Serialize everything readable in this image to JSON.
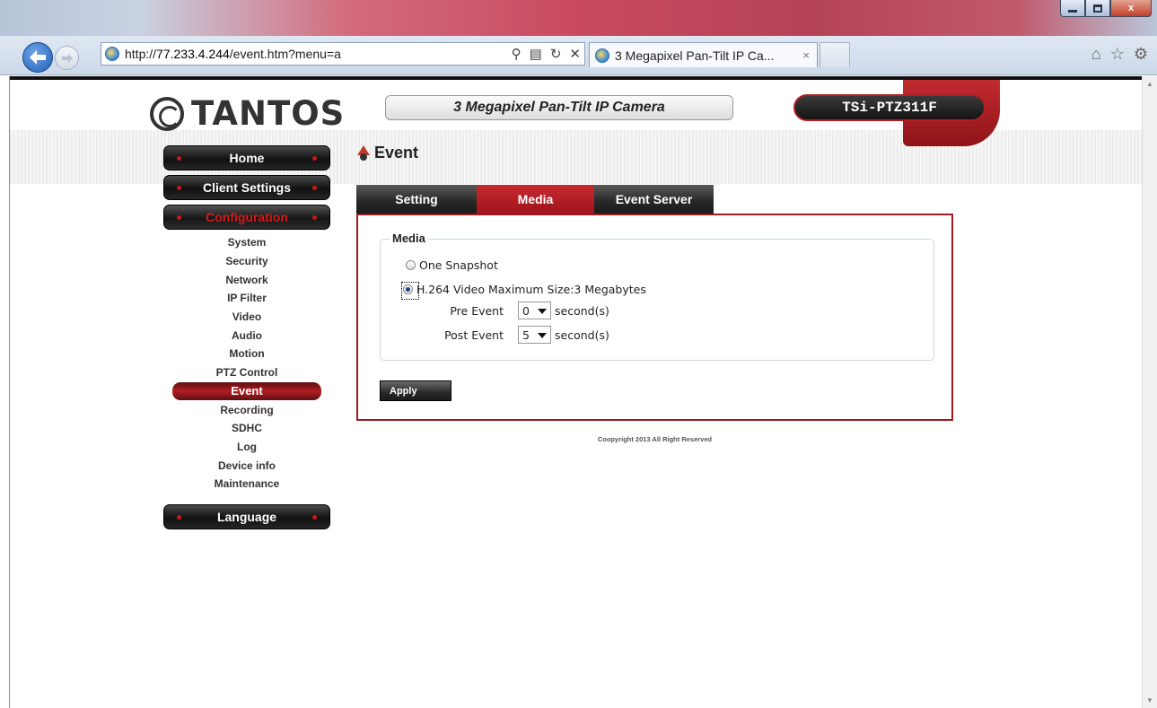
{
  "browser": {
    "url_prefix": "http://",
    "url_host": "77.233.4.244",
    "url_path": "/event.htm?menu=a",
    "tab_title": "3 Megapixel Pan-Tilt IP Ca...",
    "tab_close": "×",
    "window_close": "x"
  },
  "header": {
    "logo_text": "TANTOS",
    "product_name": "3 Megapixel Pan-Tilt IP Camera",
    "model": "TSi-PTZ311F"
  },
  "menu": {
    "home": "Home",
    "client_settings": "Client Settings",
    "configuration": "Configuration",
    "language": "Language",
    "items": [
      "System",
      "Security",
      "Network",
      "IP Filter",
      "Video",
      "Audio",
      "Motion",
      "PTZ Control",
      "Event",
      "Recording",
      "SDHC",
      "Log",
      "Device info",
      "Maintenance"
    ],
    "active_item": "Event"
  },
  "page": {
    "title": "Event",
    "tabs": [
      "Setting",
      "Media",
      "Event Server"
    ],
    "active_tab": "Media"
  },
  "media": {
    "legend": "Media",
    "option_snapshot": "One Snapshot",
    "option_video": "H.264 Video Maximum Size:3 Megabytes",
    "selected_option": "H.264 Video Maximum Size:3 Megabytes",
    "pre_event_label": "Pre Event",
    "pre_event_value": "0",
    "post_event_label": "Post Event",
    "post_event_value": "5",
    "unit": "second(s)",
    "apply": "Apply"
  },
  "footer": {
    "copyright": "Coopyright 2013 All Right Reserved"
  },
  "colors": {
    "accent_red": "#b31d23",
    "menu_black": "#111111"
  }
}
